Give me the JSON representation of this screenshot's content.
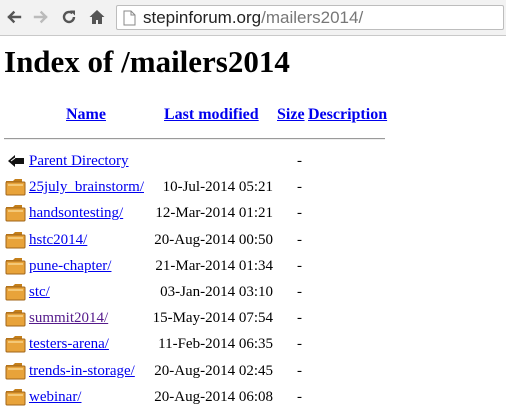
{
  "browser": {
    "url_host": "stepinforum.org",
    "url_path": "/mailers2014/"
  },
  "page": {
    "title": "Index of /mailers2014"
  },
  "table": {
    "headers": {
      "name": "Name",
      "last_modified": "Last modified",
      "size": "Size",
      "description": "Description"
    },
    "rows": [
      {
        "name": "Parent Directory",
        "date": "",
        "size": "-",
        "icon": "back-arrow-icon",
        "visited": false
      },
      {
        "name": "25july_brainstorm/",
        "date": "10-Jul-2014 05:21",
        "size": "-",
        "icon": "folder-icon",
        "visited": false
      },
      {
        "name": "handsontesting/",
        "date": "12-Mar-2014 01:21",
        "size": "-",
        "icon": "folder-icon",
        "visited": false
      },
      {
        "name": "hstc2014/",
        "date": "20-Aug-2014 00:50",
        "size": "-",
        "icon": "folder-icon",
        "visited": false
      },
      {
        "name": "pune-chapter/",
        "date": "21-Mar-2014 01:34",
        "size": "-",
        "icon": "folder-icon",
        "visited": false
      },
      {
        "name": "stc/",
        "date": "03-Jan-2014 03:10",
        "size": "-",
        "icon": "folder-icon",
        "visited": false
      },
      {
        "name": "summit2014/",
        "date": "15-May-2014 07:54",
        "size": "-",
        "icon": "folder-icon",
        "visited": true
      },
      {
        "name": "testers-arena/",
        "date": "11-Feb-2014 06:35",
        "size": "-",
        "icon": "folder-icon",
        "visited": false
      },
      {
        "name": "trends-in-storage/",
        "date": "20-Aug-2014 02:45",
        "size": "-",
        "icon": "folder-icon",
        "visited": false
      },
      {
        "name": "webinar/",
        "date": "20-Aug-2014 06:08",
        "size": "-",
        "icon": "folder-icon",
        "visited": false
      }
    ]
  },
  "colors": {
    "link": "#0000ee",
    "visited_link": "#551a8b",
    "folder": "#e8a33a"
  }
}
